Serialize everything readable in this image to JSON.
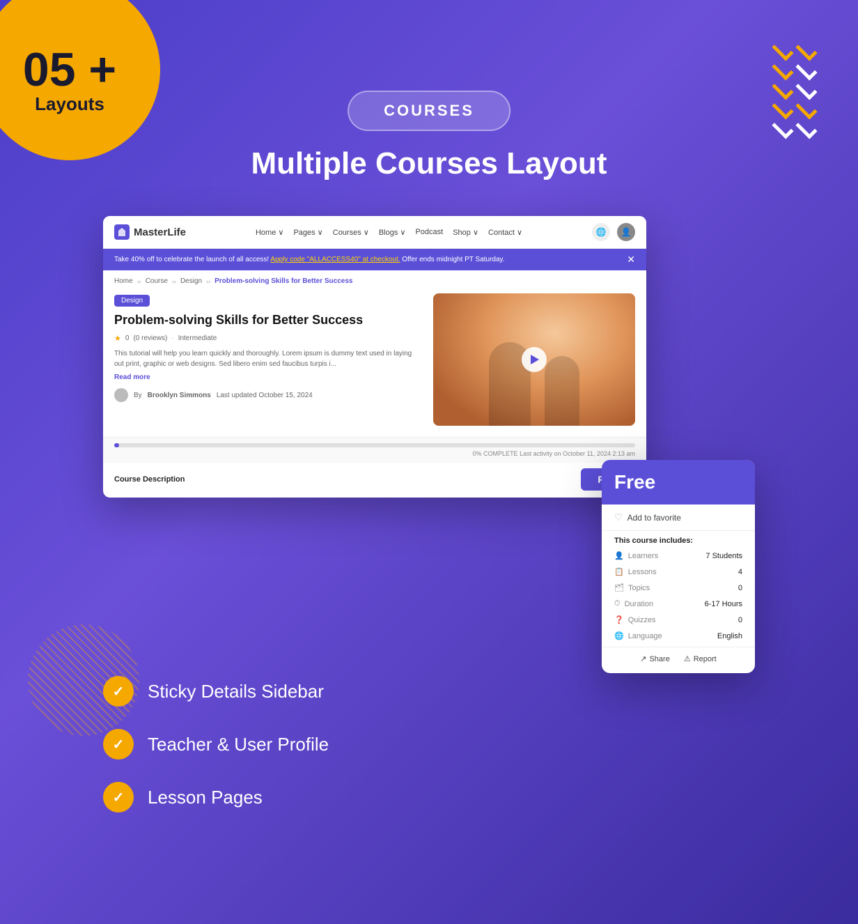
{
  "badge": {
    "number": "05 +",
    "label": "Layouts"
  },
  "pill": {
    "text": "COURSES"
  },
  "title": "Multiple Courses Layout",
  "nav": {
    "brand": "MasterLife",
    "links": [
      "Home",
      "Pages",
      "Courses",
      "Blogs",
      "Podcast",
      "Shop",
      "Contact"
    ],
    "promo": {
      "text": "Take 40% off to celebrate the launch of all access!",
      "link_text": "Apply code \"ALLACCESS40\" at checkout.",
      "suffix": "Offer ends midnight PT Saturday."
    }
  },
  "breadcrumb": {
    "items": [
      "Home",
      "Course",
      "Design",
      "Problem-solving Skills for Better Success"
    ]
  },
  "course": {
    "badge": "Design",
    "title": "Problem-solving Skills for Better Success",
    "rating": "0",
    "reviews": "(0 reviews)",
    "level": "Intermediate",
    "description": "This tutorial will help you learn quickly and thoroughly. Lorem ipsum is dummy text used in laying out print, graphic or web designs. Sed libero enim sed faucibus turpis i...",
    "read_more": "Read more",
    "author": "Brooklyn Simmons",
    "author_prefix": "By",
    "updated": "Last updated October 15, 2024",
    "progress_text": "0% COMPLETE  Last activity on October 11, 2024 2:13 am",
    "desc_label": "Course Description",
    "free_btn": "Free"
  },
  "sidebar": {
    "price": "Free",
    "favorite": "Add to favorite",
    "includes_label": "This course includes:",
    "rows": [
      {
        "icon": "👤",
        "label": "Learners",
        "value": "7 Students"
      },
      {
        "icon": "📋",
        "label": "Lessons",
        "value": "4"
      },
      {
        "icon": "🗂",
        "label": "Topics",
        "value": "0"
      },
      {
        "icon": "⏱",
        "label": "Duration",
        "value": "6-17 Hours"
      },
      {
        "icon": "❓",
        "label": "Quizzes",
        "value": "0"
      },
      {
        "icon": "🌐",
        "label": "Language",
        "value": "English"
      }
    ],
    "actions": [
      "Share",
      "Report"
    ]
  },
  "features": [
    {
      "text": "Sticky Details Sidebar"
    },
    {
      "text": "Teacher & User Profile"
    },
    {
      "text": "Lesson Pages"
    }
  ],
  "chevrons": {
    "rows": [
      {
        "color": "gold"
      },
      {
        "color": "gold"
      },
      {
        "color": "gold"
      },
      {
        "color": "gold"
      },
      {
        "color": "white"
      },
      {
        "color": "gold"
      },
      {
        "color": "white"
      }
    ]
  }
}
